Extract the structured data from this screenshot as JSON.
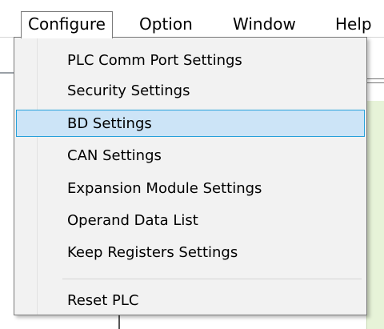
{
  "menubar": {
    "items": [
      {
        "label": "Configure",
        "active": true
      },
      {
        "label": "Option",
        "active": false
      },
      {
        "label": "Window",
        "active": false
      },
      {
        "label": "Help",
        "active": false
      }
    ]
  },
  "dropdown": {
    "items": [
      {
        "label": "PLC Comm Port Settings",
        "highlighted": false
      },
      {
        "label": "Security Settings",
        "highlighted": false
      },
      {
        "label": "BD Settings",
        "highlighted": true
      },
      {
        "label": "CAN Settings",
        "highlighted": false
      },
      {
        "label": "Expansion Module Settings",
        "highlighted": false
      },
      {
        "label": "Operand Data List",
        "highlighted": false
      },
      {
        "label": "Keep Registers Settings",
        "highlighted": false
      },
      {
        "label": "Reset PLC",
        "highlighted": false
      }
    ]
  },
  "colors": {
    "highlight_fill": "#cce4f7",
    "highlight_border": "#26a0da",
    "menu_background": "#f2f2f2",
    "workspace_green": "#e7f3d8"
  }
}
